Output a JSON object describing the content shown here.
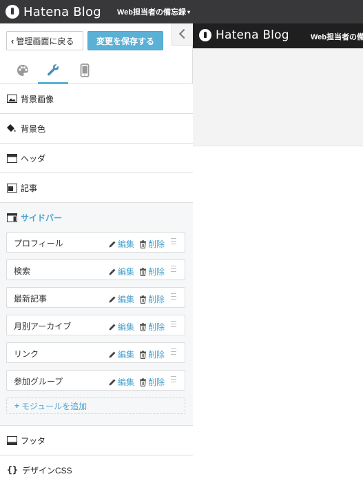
{
  "topbar": {
    "logo_text": "Hatena Blog",
    "blog_name": "Web担当者の備忘録",
    "caret": "▾"
  },
  "sidebar": {
    "back_label": "管理画面に戻る",
    "save_label": "変更を保存する",
    "tabs": [
      {
        "icon": "palette-icon"
      },
      {
        "icon": "wrench-icon",
        "active": true
      },
      {
        "icon": "smartphone-icon"
      }
    ],
    "sections": [
      {
        "label": "背景画像",
        "icon": "image-icon"
      },
      {
        "label": "背景色",
        "icon": "paint-bucket-icon"
      },
      {
        "label": "ヘッダ",
        "icon": "layout-header-icon"
      },
      {
        "label": "記事",
        "icon": "layout-article-icon"
      },
      {
        "label": "サイドバー",
        "icon": "layout-sidebar-icon",
        "active": true
      },
      {
        "label": "フッタ",
        "icon": "layout-footer-icon"
      },
      {
        "label": "デザインCSS",
        "icon": "css-braces-icon"
      }
    ],
    "modules": [
      {
        "name": "プロフィール"
      },
      {
        "name": "検索"
      },
      {
        "name": "最新記事"
      },
      {
        "name": "月別アーカイブ"
      },
      {
        "name": "リンク"
      },
      {
        "name": "参加グループ"
      }
    ],
    "edit_label": "編集",
    "delete_label": "削除",
    "add_module_label": "モジュールを追加"
  },
  "preview": {
    "logo_text": "Hatena Blog",
    "blog_name": "Web担当者の備忘録"
  },
  "colors": {
    "topbar_bg": "#38383a",
    "accent": "#5bb0d6",
    "link": "#4aa3d0",
    "preview_bar_bg": "#1f1f1f"
  }
}
